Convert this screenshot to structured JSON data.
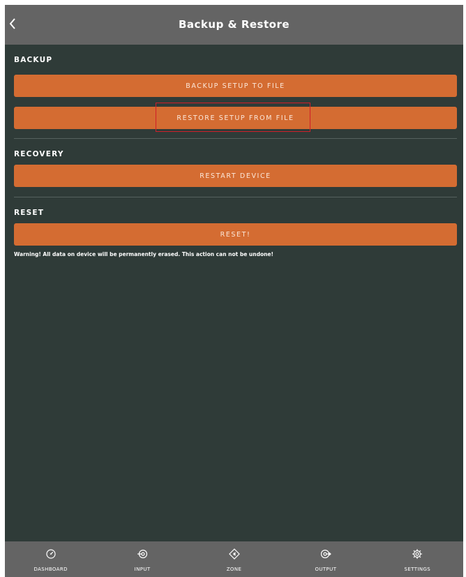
{
  "header": {
    "title": "Backup & Restore",
    "back_icon": "chevron-left-icon"
  },
  "sections": {
    "backup": {
      "title": "BACKUP",
      "backup_button": "BACKUP SETUP TO FILE",
      "restore_button": "RESTORE SETUP FROM FILE"
    },
    "recovery": {
      "title": "RECOVERY",
      "restart_button": "RESTART DEVICE"
    },
    "reset": {
      "title": "RESET",
      "reset_button": "RESET!",
      "warning": "Warning! All data on device will be permanently erased. This action can not be undone!"
    }
  },
  "nav": {
    "items": [
      {
        "label": "DASHBOARD",
        "icon": "gauge-icon"
      },
      {
        "label": "INPUT",
        "icon": "input-icon"
      },
      {
        "label": "ZONE",
        "icon": "zone-icon"
      },
      {
        "label": "OUTPUT",
        "icon": "output-icon"
      },
      {
        "label": "SETTINGS",
        "icon": "gear-icon"
      }
    ]
  },
  "colors": {
    "background": "#2f3b38",
    "header": "#646464",
    "accent": "#d46c32",
    "highlight": "#d01f2a"
  }
}
